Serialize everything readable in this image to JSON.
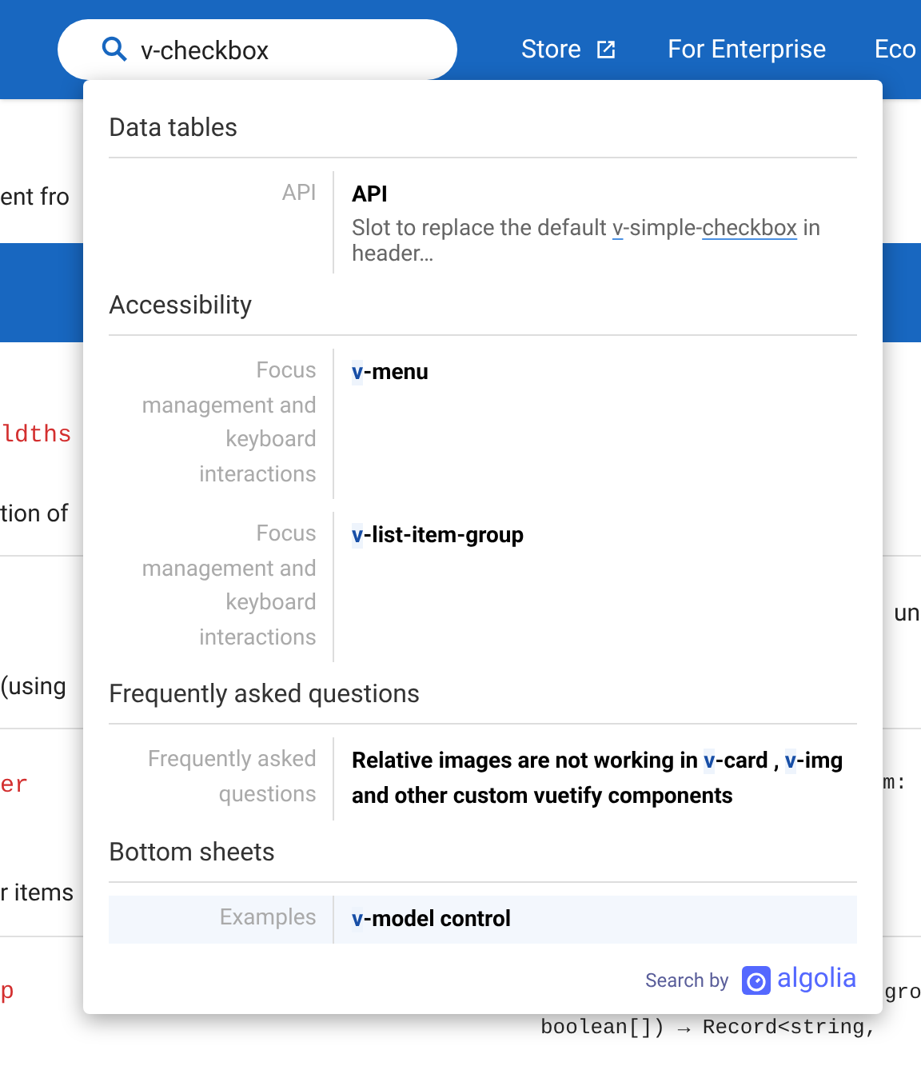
{
  "header": {
    "search": {
      "value": "v-checkbox"
    },
    "nav": [
      {
        "label": "Store",
        "external": true
      },
      {
        "label": "For Enterprise",
        "external": false
      },
      {
        "label": "Eco",
        "external": false
      }
    ]
  },
  "background": {
    "left": [
      {
        "text": "ent fro",
        "kind": "text"
      },
      {
        "text": "ldths",
        "kind": "code"
      },
      {
        "text": "tion of",
        "kind": "text"
      },
      {
        "text": "(using",
        "kind": "chip"
      },
      {
        "text": "er",
        "kind": "code"
      },
      {
        "text": "r items",
        "kind": "text"
      },
      {
        "text": "p",
        "kind": "code"
      }
    ],
    "right": [
      {
        "text": "un",
        "kind": "text"
      },
      {
        "text": "m:",
        "kind": "mono"
      },
      {
        "text": "gro",
        "kind": "mono"
      },
      {
        "text": "boolean[]) → Record<string,",
        "kind": "mono"
      }
    ]
  },
  "results": [
    {
      "section": "Data tables",
      "hits": [
        {
          "category": "API",
          "title": [
            {
              "text": "API",
              "hit": false
            }
          ],
          "snippet": [
            {
              "text": "Slot to replace the default ",
              "hit": false
            },
            {
              "text": "v",
              "hit": true
            },
            {
              "text": "-simple-",
              "hit": false
            },
            {
              "text": "checkbox",
              "hit": true
            },
            {
              "text": " in header…",
              "hit": false
            }
          ],
          "selected": false
        }
      ]
    },
    {
      "section": "Accessibility",
      "hits": [
        {
          "category": "Focus management and keyboard interactions",
          "title": [
            {
              "text": "v",
              "hit": true
            },
            {
              "text": "-menu",
              "hit": false
            }
          ],
          "selected": false
        },
        {
          "category": "Focus management and keyboard interactions",
          "title": [
            {
              "text": "v",
              "hit": true
            },
            {
              "text": "-list-item-group",
              "hit": false
            }
          ],
          "selected": false
        }
      ]
    },
    {
      "section": "Frequently asked questions",
      "hits": [
        {
          "category": "Frequently asked questions",
          "title": [
            {
              "text": "Relative images are not working in ",
              "hit": false
            },
            {
              "text": "v",
              "hit": true
            },
            {
              "text": "-card , ",
              "hit": false
            },
            {
              "text": "v",
              "hit": true
            },
            {
              "text": "-img and other custom vuetify components",
              "hit": false
            }
          ],
          "selected": false
        }
      ]
    },
    {
      "section": "Bottom sheets",
      "hits": [
        {
          "category": "Examples",
          "title": [
            {
              "text": "v",
              "hit": true
            },
            {
              "text": "-model control",
              "hit": false
            }
          ],
          "selected": true
        }
      ]
    }
  ],
  "footer": {
    "label": "Search by",
    "brand": "algolia"
  }
}
